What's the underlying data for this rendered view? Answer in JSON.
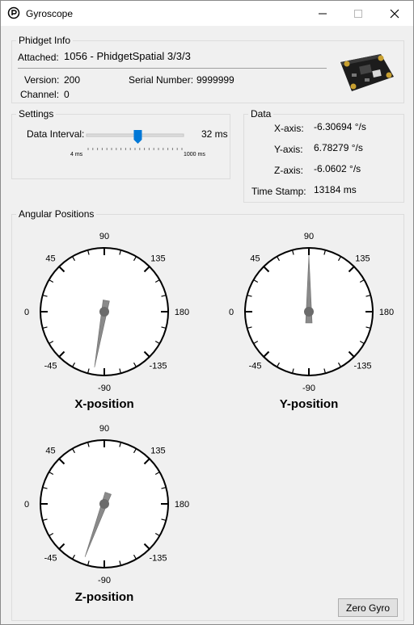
{
  "window": {
    "title": "Gyroscope"
  },
  "phidget_info": {
    "group_label": "Phidget Info",
    "attached_label": "Attached:",
    "attached_value": "1056 - PhidgetSpatial 3/3/3",
    "version_label": "Version:",
    "version_value": "200",
    "serial_label": "Serial Number:",
    "serial_value": "9999999",
    "channel_label": "Channel:",
    "channel_value": "0"
  },
  "settings": {
    "group_label": "Settings",
    "interval_label": "Data Interval:",
    "interval_value": "32 ms",
    "slider_min_label": "4 ms",
    "slider_max_label": "1000 ms",
    "slider_fraction": 0.53
  },
  "data": {
    "group_label": "Data",
    "x_label": "X-axis:",
    "x_value": "-6.30694 °/s",
    "y_label": "Y-axis:",
    "y_value": "6.78279 °/s",
    "z_label": "Z-axis:",
    "z_value": "-6.0602 °/s",
    "timestamp_label": "Time Stamp:",
    "timestamp_value": "13184 ms"
  },
  "angular": {
    "group_label": "Angular Positions",
    "gauges": [
      {
        "title": "X-position",
        "angle": -80
      },
      {
        "title": "Y-position",
        "angle": 90
      },
      {
        "title": "Z-position",
        "angle": -70
      }
    ],
    "dial_labels": [
      "90",
      "135",
      "180",
      "-135",
      "-90",
      "-45",
      "0",
      "45"
    ]
  },
  "zero_button": "Zero Gyro",
  "colors": {
    "slider_thumb": "#0078d7",
    "needle": "#8a8a8a"
  }
}
